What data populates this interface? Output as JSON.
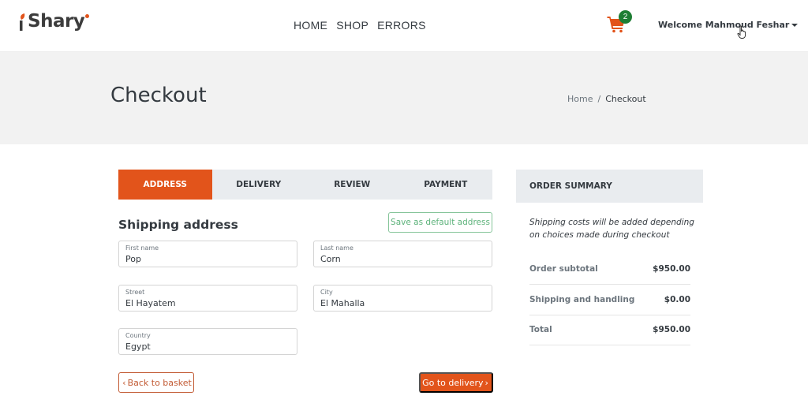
{
  "brand": {
    "name": "Shary",
    "accent": "#e2541b"
  },
  "nav": {
    "links": [
      "HOME",
      "SHOP",
      "ERRORS"
    ]
  },
  "cart": {
    "icon": "shopping-cart-icon",
    "count": "2"
  },
  "user": {
    "greeting": "Welcome Mahmoud Feshar"
  },
  "header": {
    "title": "Checkout",
    "breadcrumb": {
      "home": "Home",
      "separator": "/",
      "current": "Checkout"
    }
  },
  "checkout": {
    "tabs": [
      {
        "label": "Address",
        "active": true
      },
      {
        "label": "Delivery",
        "active": false
      },
      {
        "label": "Review",
        "active": false
      },
      {
        "label": "Payment",
        "active": false
      }
    ],
    "section_title": "Shipping address",
    "save_default_label": "Save as default address",
    "fields": {
      "first_name": {
        "label": "First name",
        "value": "Pop"
      },
      "last_name": {
        "label": "Last name",
        "value": "Corn"
      },
      "street": {
        "label": "Street",
        "value": "El Hayatem"
      },
      "city": {
        "label": "City",
        "value": "El Mahalla"
      },
      "country": {
        "label": "Country",
        "value": "Egypt"
      }
    },
    "back_label": "Back to basket",
    "next_label": "Go to delivery"
  },
  "summary": {
    "title": "Order summary",
    "note": "Shipping costs will be added depending on choices made during checkout",
    "rows": [
      {
        "label": "Order subtotal",
        "value": "$950.00"
      },
      {
        "label": "Shipping and handling",
        "value": "$0.00"
      },
      {
        "label": "Total",
        "value": "$950.00"
      }
    ]
  }
}
